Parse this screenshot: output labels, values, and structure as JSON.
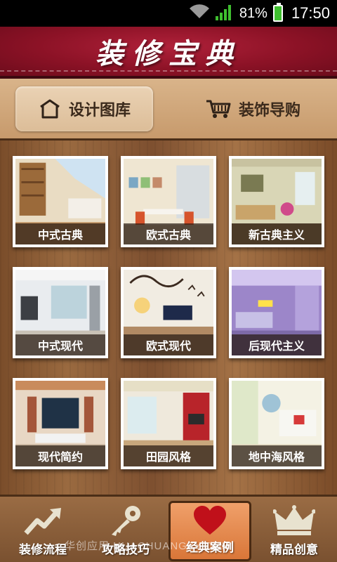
{
  "status_bar": {
    "battery": "81%",
    "time": "17:50"
  },
  "header": {
    "title": "装修宝典"
  },
  "tabs": [
    {
      "label": "设计图库",
      "icon": "house-outline-icon",
      "active": true
    },
    {
      "label": "装饰导购",
      "icon": "shopping-cart-icon",
      "active": false
    }
  ],
  "styles": [
    {
      "label": "中式古典"
    },
    {
      "label": "欧式古典"
    },
    {
      "label": "新古典主义"
    },
    {
      "label": "中式现代"
    },
    {
      "label": "欧式现代"
    },
    {
      "label": "后现代主义"
    },
    {
      "label": "现代简约"
    },
    {
      "label": "田园风格"
    },
    {
      "label": "地中海风格"
    }
  ],
  "bottom_nav": [
    {
      "label": "装修流程",
      "icon": "rising-arrow-icon",
      "active": false
    },
    {
      "label": "攻略技巧",
      "icon": "key-icon",
      "active": false
    },
    {
      "label": "经典案例",
      "icon": "heart-icon",
      "active": true
    },
    {
      "label": "精品创意",
      "icon": "crown-icon",
      "active": false
    }
  ],
  "watermark": "华创应用  HUACHUANGZY.COM",
  "colors": {
    "header_red": "#8c1226",
    "wood": "#8a5a34",
    "active_nav": "#e08844"
  }
}
